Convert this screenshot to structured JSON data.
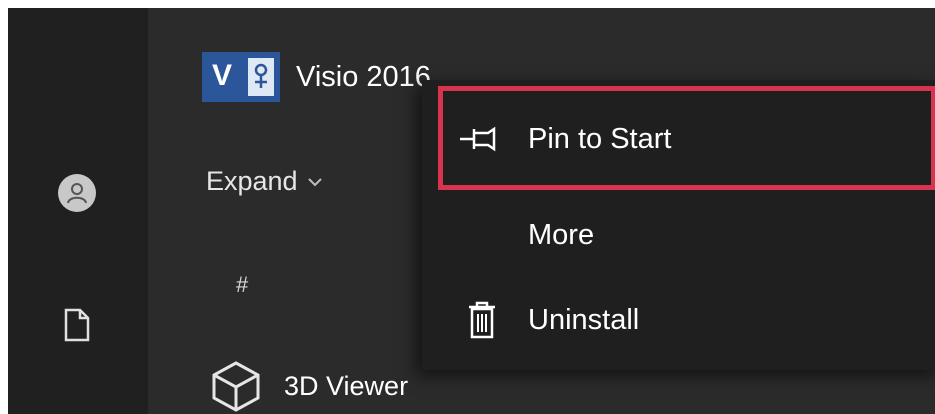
{
  "app": {
    "tile_letter": "V",
    "name": "Visio 2016"
  },
  "nav": {
    "expand_label": "Expand",
    "section_letter": "#"
  },
  "apps": [
    {
      "name": "3D Viewer"
    }
  ],
  "context_menu": {
    "items": [
      {
        "label": "Pin to Start",
        "icon": "pin-icon",
        "highlighted": true
      },
      {
        "label": "More"
      },
      {
        "label": "Uninstall",
        "icon": "trash-icon"
      }
    ]
  },
  "colors": {
    "highlight_border": "#d9344f",
    "visio_blue": "#2b579a",
    "menu_bg": "#1f1f1f"
  }
}
